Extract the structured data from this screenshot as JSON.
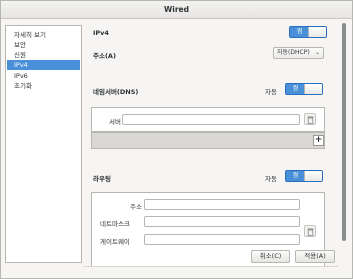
{
  "window": {
    "title": "Wired"
  },
  "sidebar": {
    "items": [
      {
        "label": "자세히 보기",
        "active": false
      },
      {
        "label": "보안",
        "active": false
      },
      {
        "label": "신원",
        "active": false
      },
      {
        "label": "IPv4",
        "active": true
      },
      {
        "label": "IPv6",
        "active": false
      },
      {
        "label": "초기화",
        "active": false
      }
    ]
  },
  "ipv4": {
    "section_label": "IPv4",
    "toggle_on_label": "켬"
  },
  "address": {
    "label": "주소(A)",
    "method_value": "자동(DHCP)"
  },
  "dns": {
    "label": "네임서버(DNS)",
    "auto_label": "자동",
    "toggle_on_label": "켬",
    "server_label": "서버",
    "server_value": "",
    "add_label": "+"
  },
  "routes": {
    "label": "라우팅",
    "auto_label": "자동",
    "toggle_on_label": "켬",
    "address_label": "주소",
    "netmask_label": "네트마스크",
    "gateway_label": "게이트웨이",
    "address_value": "",
    "netmask_value": "",
    "gateway_value": ""
  },
  "footer": {
    "cancel_label": "취소(C)",
    "apply_label": "적용(A)"
  },
  "colors": {
    "accent": "#4a90d9",
    "window_bg": "#f6f5f4"
  }
}
